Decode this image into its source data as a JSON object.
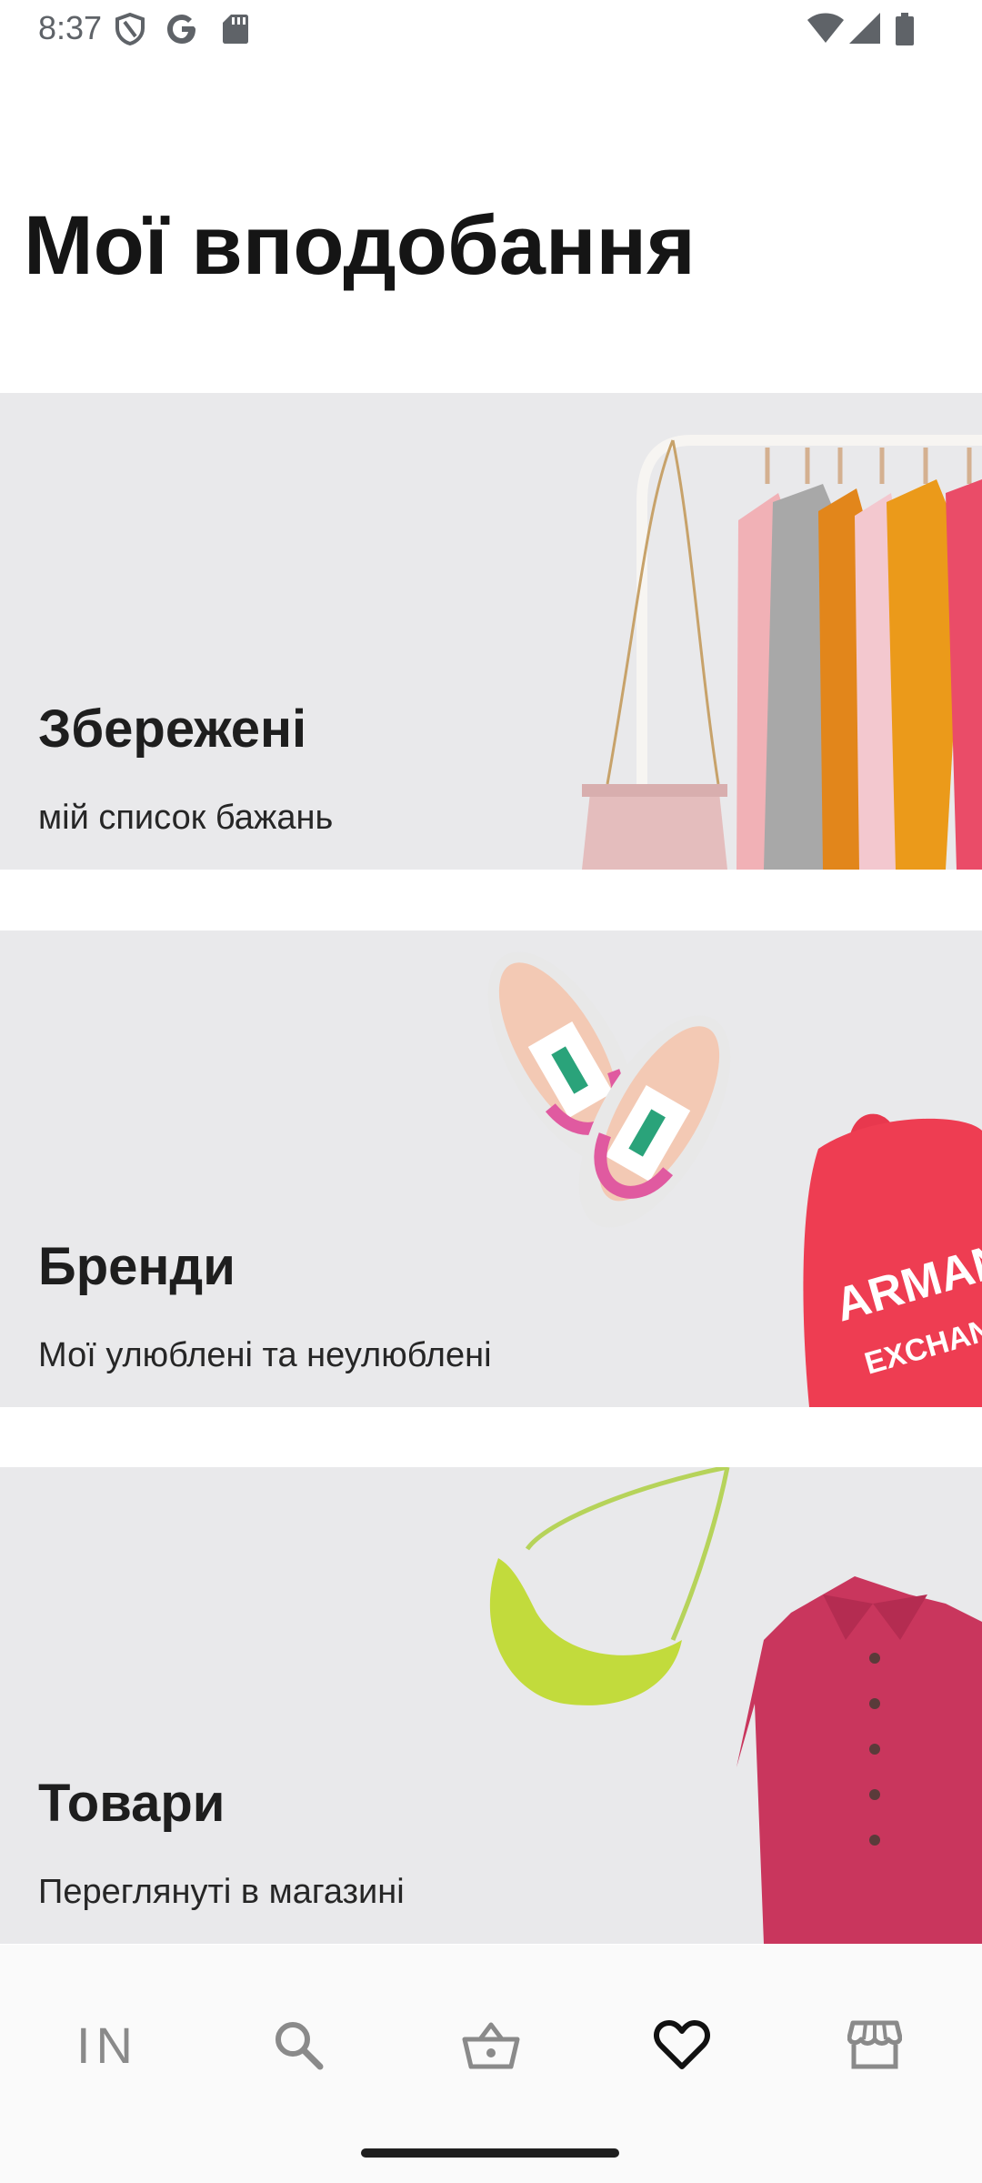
{
  "status_bar": {
    "time": "8:37",
    "icons": [
      "shield-icon",
      "google-g-icon",
      "sd-card-icon",
      "wifi-icon",
      "signal-icon",
      "battery-icon"
    ]
  },
  "page": {
    "title": "Мої вподобання"
  },
  "cards": [
    {
      "title": "Збережені",
      "subtitle": "мій список бажань",
      "image": "clothes-rack-and-handbag"
    },
    {
      "title": "Бренди",
      "subtitle": "Мої улюблені та неулюблені",
      "image": "sneakers-and-backpack",
      "backpack_text": [
        "ARMANI",
        "EXCHANGE"
      ]
    },
    {
      "title": "Товари",
      "subtitle": "Переглянуті в магазині",
      "image": "bag-and-cardigan"
    }
  ],
  "bottom_nav": {
    "items": [
      {
        "name": "home",
        "label": "IN",
        "icon": "logo-icon",
        "active": false
      },
      {
        "name": "search",
        "icon": "search-icon",
        "active": false
      },
      {
        "name": "basket",
        "icon": "basket-icon",
        "active": false
      },
      {
        "name": "favorites",
        "icon": "heart-icon",
        "active": true
      },
      {
        "name": "stores",
        "icon": "store-icon",
        "active": false
      }
    ]
  },
  "colors": {
    "card_background": "#e9e9eb",
    "text_primary": "#151515",
    "nav_inactive": "#8a8a8a",
    "nav_active": "#111111"
  }
}
